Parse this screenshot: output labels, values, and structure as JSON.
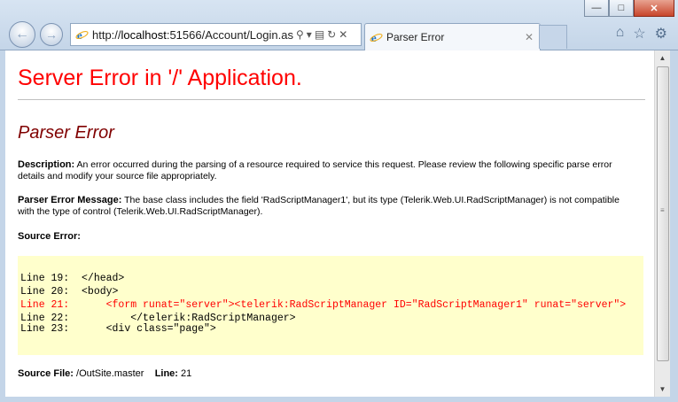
{
  "browser": {
    "address_url_prefix": "http://",
    "address_host": "localhost",
    "address_rest": ":51566/Account/Login.as",
    "tab_title": "Parser Error",
    "tab_close": "✕",
    "window_min": "—",
    "window_max": "□",
    "window_close": "✕"
  },
  "page": {
    "heading": "Server Error in '/' Application.",
    "subheading": "Parser Error",
    "description_label": "Description:",
    "description_text": " An error occurred during the parsing of a resource required to service this request. Please review the following specific parse error details and modify your source file appropriately.",
    "message_label": "Parser Error Message:",
    "message_text": " The base class includes the field 'RadScriptManager1', but its type (Telerik.Web.UI.RadScriptManager) is not compatible with the type of control (Telerik.Web.UI.RadScriptManager).",
    "source_error_label": "Source Error:",
    "code_lines": [
      "Line 19:  </head>",
      "Line 20:  <body>",
      "Line 21:      <form runat=\"server\"><telerik:RadScriptManager ID=\"RadScriptManager1\" runat=\"server\">",
      "Line 22:          </telerik:RadScriptManager>",
      "Line 23:      <div class=\"page\">"
    ],
    "source_file_label": "Source File:",
    "source_file_value": " /OutSite.master",
    "line_label": "Line:",
    "line_value": " 21"
  }
}
